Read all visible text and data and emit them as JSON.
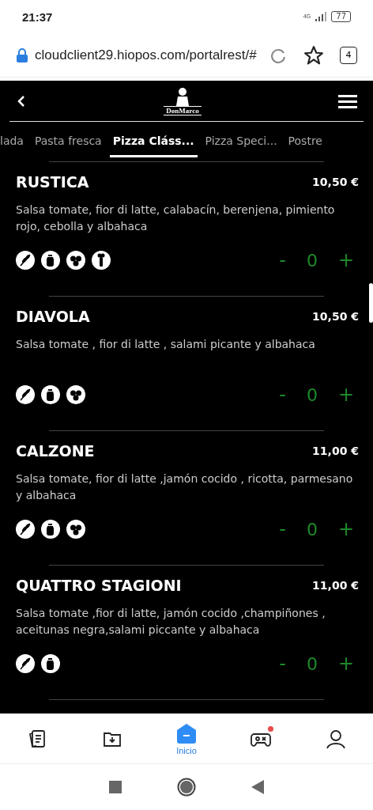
{
  "status_bar": {
    "time": "21:37",
    "network": "4G",
    "battery": "77"
  },
  "browser": {
    "url": "cloudclient29.hiopos.com/portalrest/#",
    "tab_count": "4"
  },
  "header": {
    "logo_text": "DonMarco"
  },
  "tabs": [
    {
      "label": "lada",
      "selected": false
    },
    {
      "label": "Pasta fresca",
      "selected": false
    },
    {
      "label": "Pizza Cláss...",
      "selected": true
    },
    {
      "label": "Pizza Speci...",
      "selected": false
    },
    {
      "label": "Postre",
      "selected": false
    }
  ],
  "products": [
    {
      "name": "RUSTICA",
      "price": "10,50 €",
      "description": "Salsa tomate, fior di latte, calabacín, berenjena, pimiento rojo, cebolla y albahaca",
      "allergens": [
        {
          "kind": "wheat"
        },
        {
          "kind": "jug"
        },
        {
          "kind": "balls"
        },
        {
          "kind": "stalk"
        }
      ],
      "minus": "-",
      "quantity": "0",
      "plus": "+"
    },
    {
      "name": "DIAVOLA",
      "price": "10,50 €",
      "description": "Salsa tomate , fior di latte , salami picante y albahaca",
      "allergens": [
        {
          "kind": "wheat"
        },
        {
          "kind": "jug"
        },
        {
          "kind": "balls"
        }
      ],
      "minus": "-",
      "quantity": "0",
      "plus": "+"
    },
    {
      "name": "CALZONE",
      "price": "11,00 €",
      "description": "Salsa tomate, fior di latte ,jamón cocido , ricotta, parmesano y albahaca",
      "allergens": [
        {
          "kind": "wheat"
        },
        {
          "kind": "jug"
        },
        {
          "kind": "balls"
        }
      ],
      "minus": "-",
      "quantity": "0",
      "plus": "+"
    },
    {
      "name": "QUATTRO STAGIONI",
      "price": "11,00 €",
      "description": "Salsa tomate ,fior di latte, jamón cocido ,champiñones , aceitunas negra,salami piccante y albahaca",
      "allergens": [
        {
          "kind": "wheat"
        },
        {
          "kind": "jug"
        }
      ],
      "minus": "-",
      "quantity": "0",
      "plus": "+"
    }
  ],
  "bottom_nav": [
    {
      "kind": "docs",
      "selected": false,
      "badge": false
    },
    {
      "kind": "folder",
      "selected": false,
      "badge": false
    },
    {
      "kind": "home",
      "label": "Inicio",
      "selected": true,
      "badge": false
    },
    {
      "kind": "game",
      "selected": false,
      "badge": true
    },
    {
      "kind": "user",
      "selected": false,
      "badge": false
    }
  ]
}
